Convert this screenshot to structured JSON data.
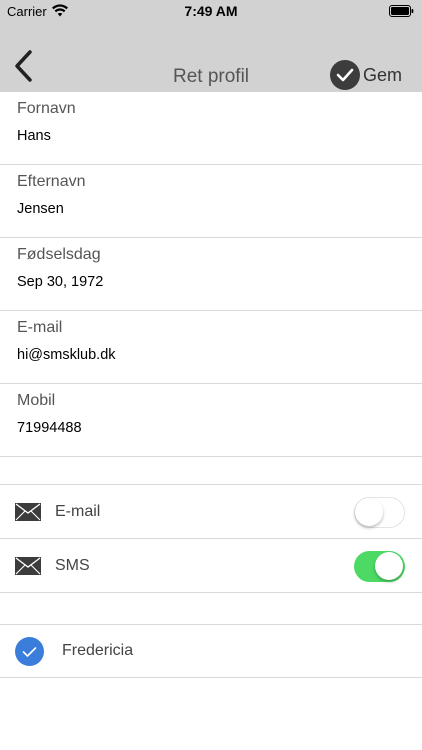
{
  "status_bar": {
    "carrier": "Carrier",
    "time": "7:49 AM"
  },
  "nav": {
    "title": "Ret profil",
    "save_label": "Gem",
    "back_icon": "chevron-left-icon",
    "save_icon": "checkmark-circle-icon"
  },
  "fields": [
    {
      "label": "Fornavn",
      "value": "Hans"
    },
    {
      "label": "Efternavn",
      "value": "Jensen"
    },
    {
      "label": "Fødselsdag",
      "value": "Sep 30, 1972"
    },
    {
      "label": "E-mail",
      "value": "hi@smsklub.dk"
    },
    {
      "label": "Mobil",
      "value": "71994488"
    }
  ],
  "notifications": [
    {
      "label": "E-mail",
      "enabled": false,
      "icon": "envelope-icon"
    },
    {
      "label": "SMS",
      "enabled": true,
      "icon": "envelope-icon"
    }
  ],
  "clubs": [
    {
      "label": "Fredericia",
      "selected": true
    }
  ],
  "colors": {
    "bar_background": "#d2d2d2",
    "switch_on": "#4cd964",
    "check_blue": "#3a7ddb"
  }
}
